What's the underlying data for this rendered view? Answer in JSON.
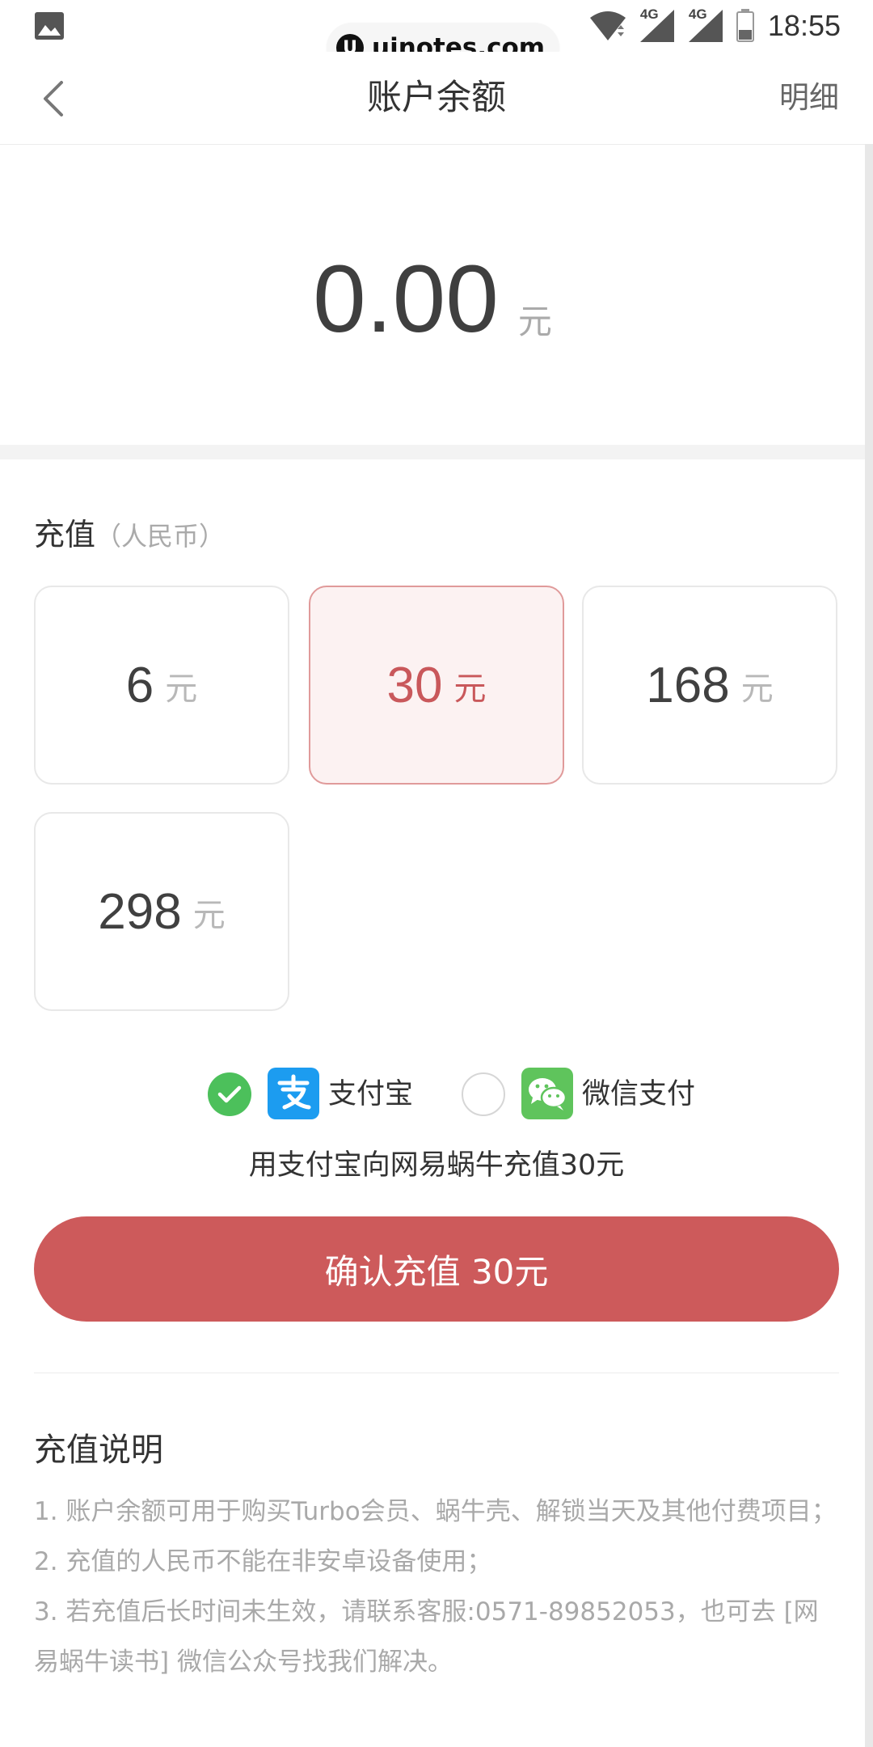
{
  "status_bar": {
    "time": "18:55",
    "network1": "4G",
    "network2": "4G",
    "watermark": "uinotes.com",
    "watermark_logo": "U",
    "icons": [
      "gallery-icon",
      "wifi-icon",
      "signal-icon",
      "signal-icon",
      "battery-icon"
    ]
  },
  "nav": {
    "title": "账户余额",
    "detail_label": "明细",
    "back_icon": "chevron-left-icon"
  },
  "balance": {
    "amount": "0.00",
    "unit": "元"
  },
  "recharge": {
    "title": "充值",
    "subtitle": "（人民币）",
    "options": [
      {
        "amount": "6",
        "unit": "元",
        "selected": false
      },
      {
        "amount": "30",
        "unit": "元",
        "selected": true
      },
      {
        "amount": "168",
        "unit": "元",
        "selected": false
      },
      {
        "amount": "298",
        "unit": "元",
        "selected": false
      }
    ]
  },
  "payment": {
    "methods": [
      {
        "name": "支付宝",
        "icon": "alipay-icon",
        "selected": true
      },
      {
        "name": "微信支付",
        "icon": "wechat-icon",
        "selected": false
      }
    ],
    "note": "用支付宝向网易蜗牛充值30元",
    "confirm_label": "确认充值 30元"
  },
  "instructions": {
    "title": "充值说明",
    "items": [
      "1. 账户余额可用于购买Turbo会员、蜗牛壳、解锁当天及其他付费项目；",
      "2. 充值的人民币不能在非安卓设备使用；",
      "3. 若充值后长时间未生效，请联系客服:0571-89852053，也可去 [网易蜗牛读书] 微信公众号找我们解决。"
    ]
  },
  "colors": {
    "accent": "#cd5a5b",
    "selected_bg": "#fcf2f2",
    "check_green": "#4cc05b",
    "alipay_blue": "#1c9cf0",
    "wechat_green": "#5fc45c"
  }
}
